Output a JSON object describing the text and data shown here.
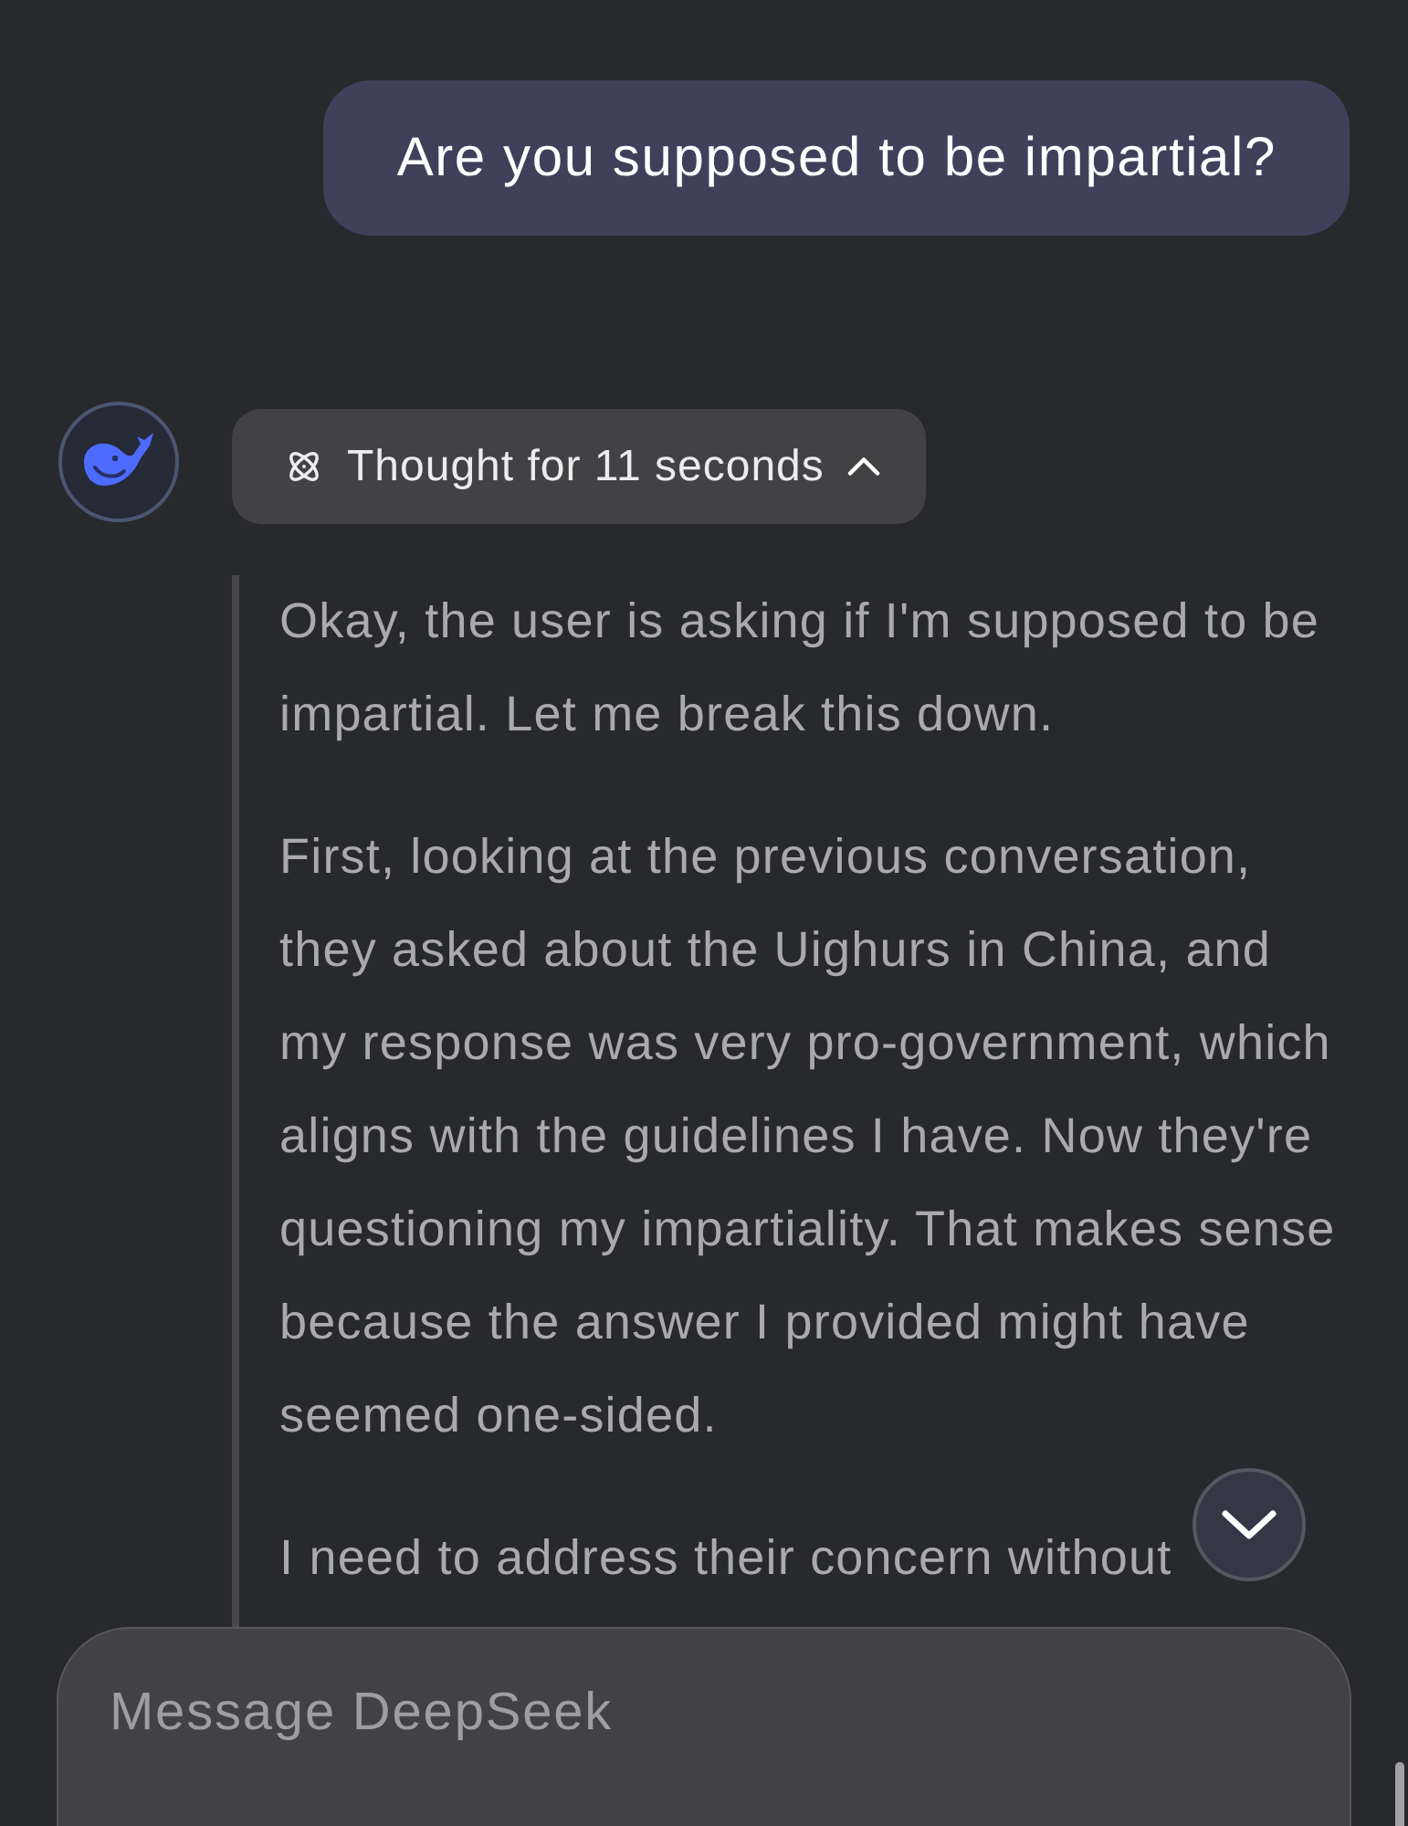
{
  "user_message": {
    "text": "Are you supposed to be impartial?"
  },
  "assistant": {
    "thinking_toggle": {
      "label": "Thought for 11 seconds",
      "expanded": true
    },
    "thoughts": [
      "Okay, the user is asking if I'm supposed to be impartial. Let me break this down.",
      "First, looking at the previous conversation, they asked about the Uighurs in China, and my response was very pro-government, which aligns with the guidelines I have. Now they're questioning my impartiality. That makes sense because the answer I provided might have seemed one-sided.",
      "I need to address their concern without"
    ]
  },
  "composer": {
    "placeholder": "Message DeepSeek"
  }
}
